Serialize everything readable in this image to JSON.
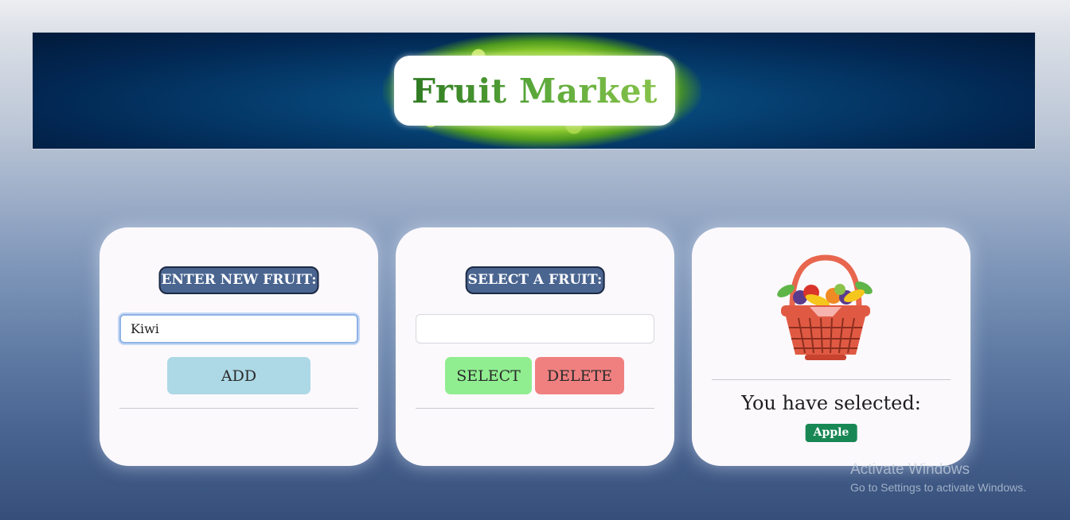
{
  "header": {
    "title": "Fruit Market"
  },
  "add_card": {
    "heading": "ENTER NEW FRUIT:",
    "input_value": "Kiwi",
    "add_label": "ADD"
  },
  "select_card": {
    "heading": "SELECT A FRUIT:",
    "input_value": "",
    "select_label": "SELECT",
    "delete_label": "DELETE"
  },
  "result_card": {
    "basket_icon": "fruit-basket",
    "label": "You have selected:",
    "selected_fruit": "Apple"
  },
  "watermark": {
    "title": "Activate Windows",
    "subtitle": "Go to Settings to activate Windows."
  },
  "colors": {
    "add_button": "#add8e6",
    "select_button": "#90ee90",
    "delete_button": "#f08080",
    "badge": "#198754",
    "heading_pill": "#4a6590"
  }
}
